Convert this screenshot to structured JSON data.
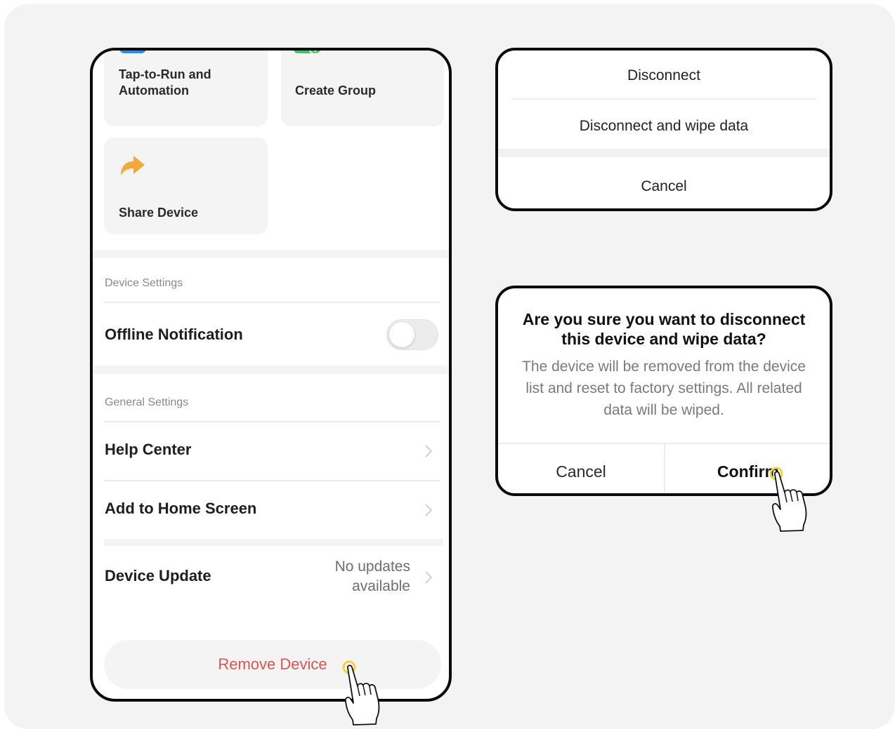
{
  "phone": {
    "tiles": {
      "tap_to_run": "Tap-to-Run and Automation",
      "create_group": "Create Group",
      "share_device": "Share Device"
    },
    "device_settings": {
      "title": "Device Settings",
      "offline_notification": {
        "label": "Offline Notification",
        "enabled": false
      }
    },
    "general_settings": {
      "title": "General Settings",
      "help_center": "Help Center",
      "add_to_home": "Add to Home Screen",
      "device_update": {
        "label": "Device Update",
        "value": "No updates available"
      }
    },
    "remove_device": "Remove Device"
  },
  "action_sheet": {
    "disconnect": "Disconnect",
    "disconnect_wipe": "Disconnect and wipe data",
    "cancel": "Cancel"
  },
  "confirm_dialog": {
    "title": "Are you sure you want to disconnect this device and wipe data?",
    "message": "The device will be removed from the device list and reset to factory settings. All related data will be wiped.",
    "cancel": "Cancel",
    "confirm": "Confirm"
  },
  "colors": {
    "danger": "#e0544e",
    "blue_icon": "#2d8cf0",
    "green_icon": "#3cc75a",
    "orange_icon": "#f5a83a",
    "tap_highlight": "#f4d23a"
  },
  "icons": [
    "checkbox-icon",
    "create-group-icon",
    "share-arrow-icon",
    "chevron-right-icon",
    "hand-pointer-icon"
  ]
}
